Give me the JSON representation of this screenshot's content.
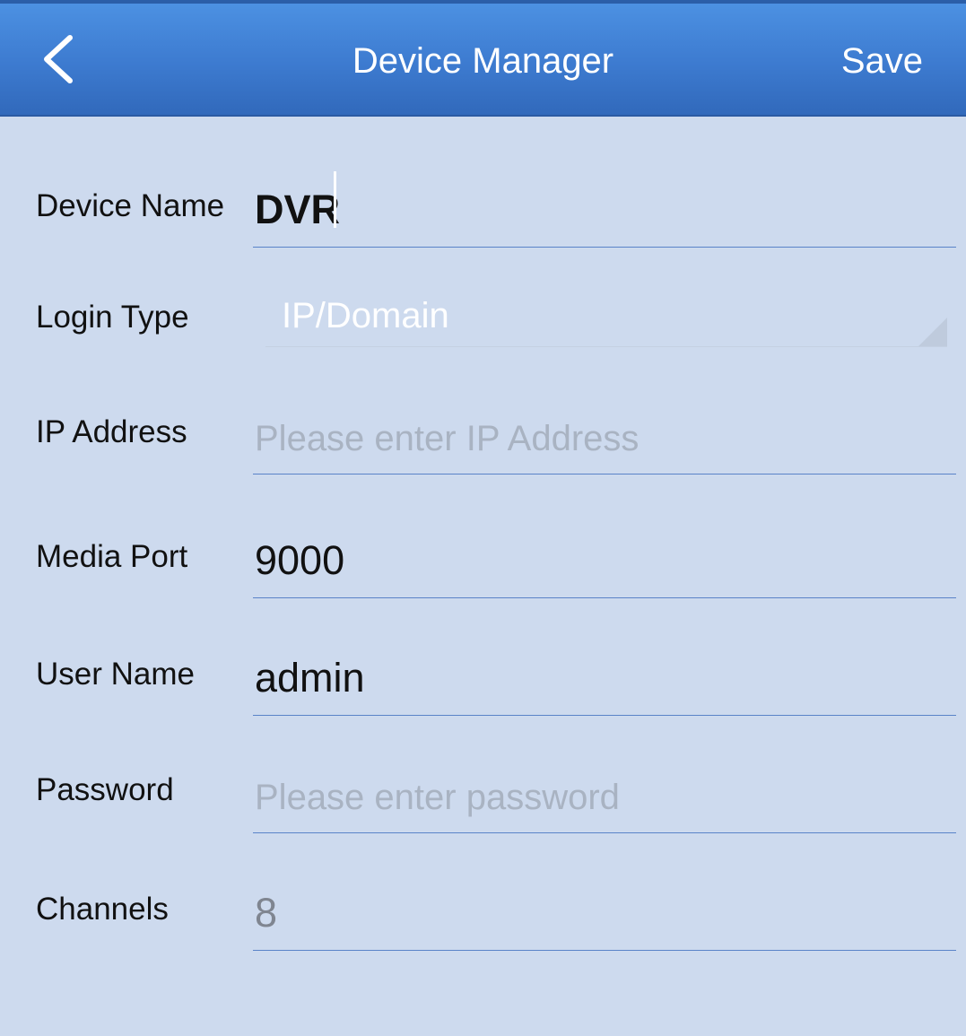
{
  "header": {
    "title": "Device Manager",
    "save_label": "Save",
    "back_icon": "chevron-left-icon"
  },
  "form": {
    "device_name": {
      "label": "Device Name",
      "value": "DVR"
    },
    "login_type": {
      "label": "Login Type",
      "value": "IP/Domain"
    },
    "ip_address": {
      "label": "IP Address",
      "value": "",
      "placeholder": "Please enter IP Address"
    },
    "media_port": {
      "label": "Media Port",
      "value": "9000"
    },
    "user_name": {
      "label": "User Name",
      "value": "admin"
    },
    "password": {
      "label": "Password",
      "value": "",
      "placeholder": "Please enter password"
    },
    "channels": {
      "label": "Channels",
      "value": "8"
    }
  },
  "colors": {
    "header_blue": "#3d7bd0",
    "background": "#cddaee",
    "underline": "#5a83c8"
  }
}
